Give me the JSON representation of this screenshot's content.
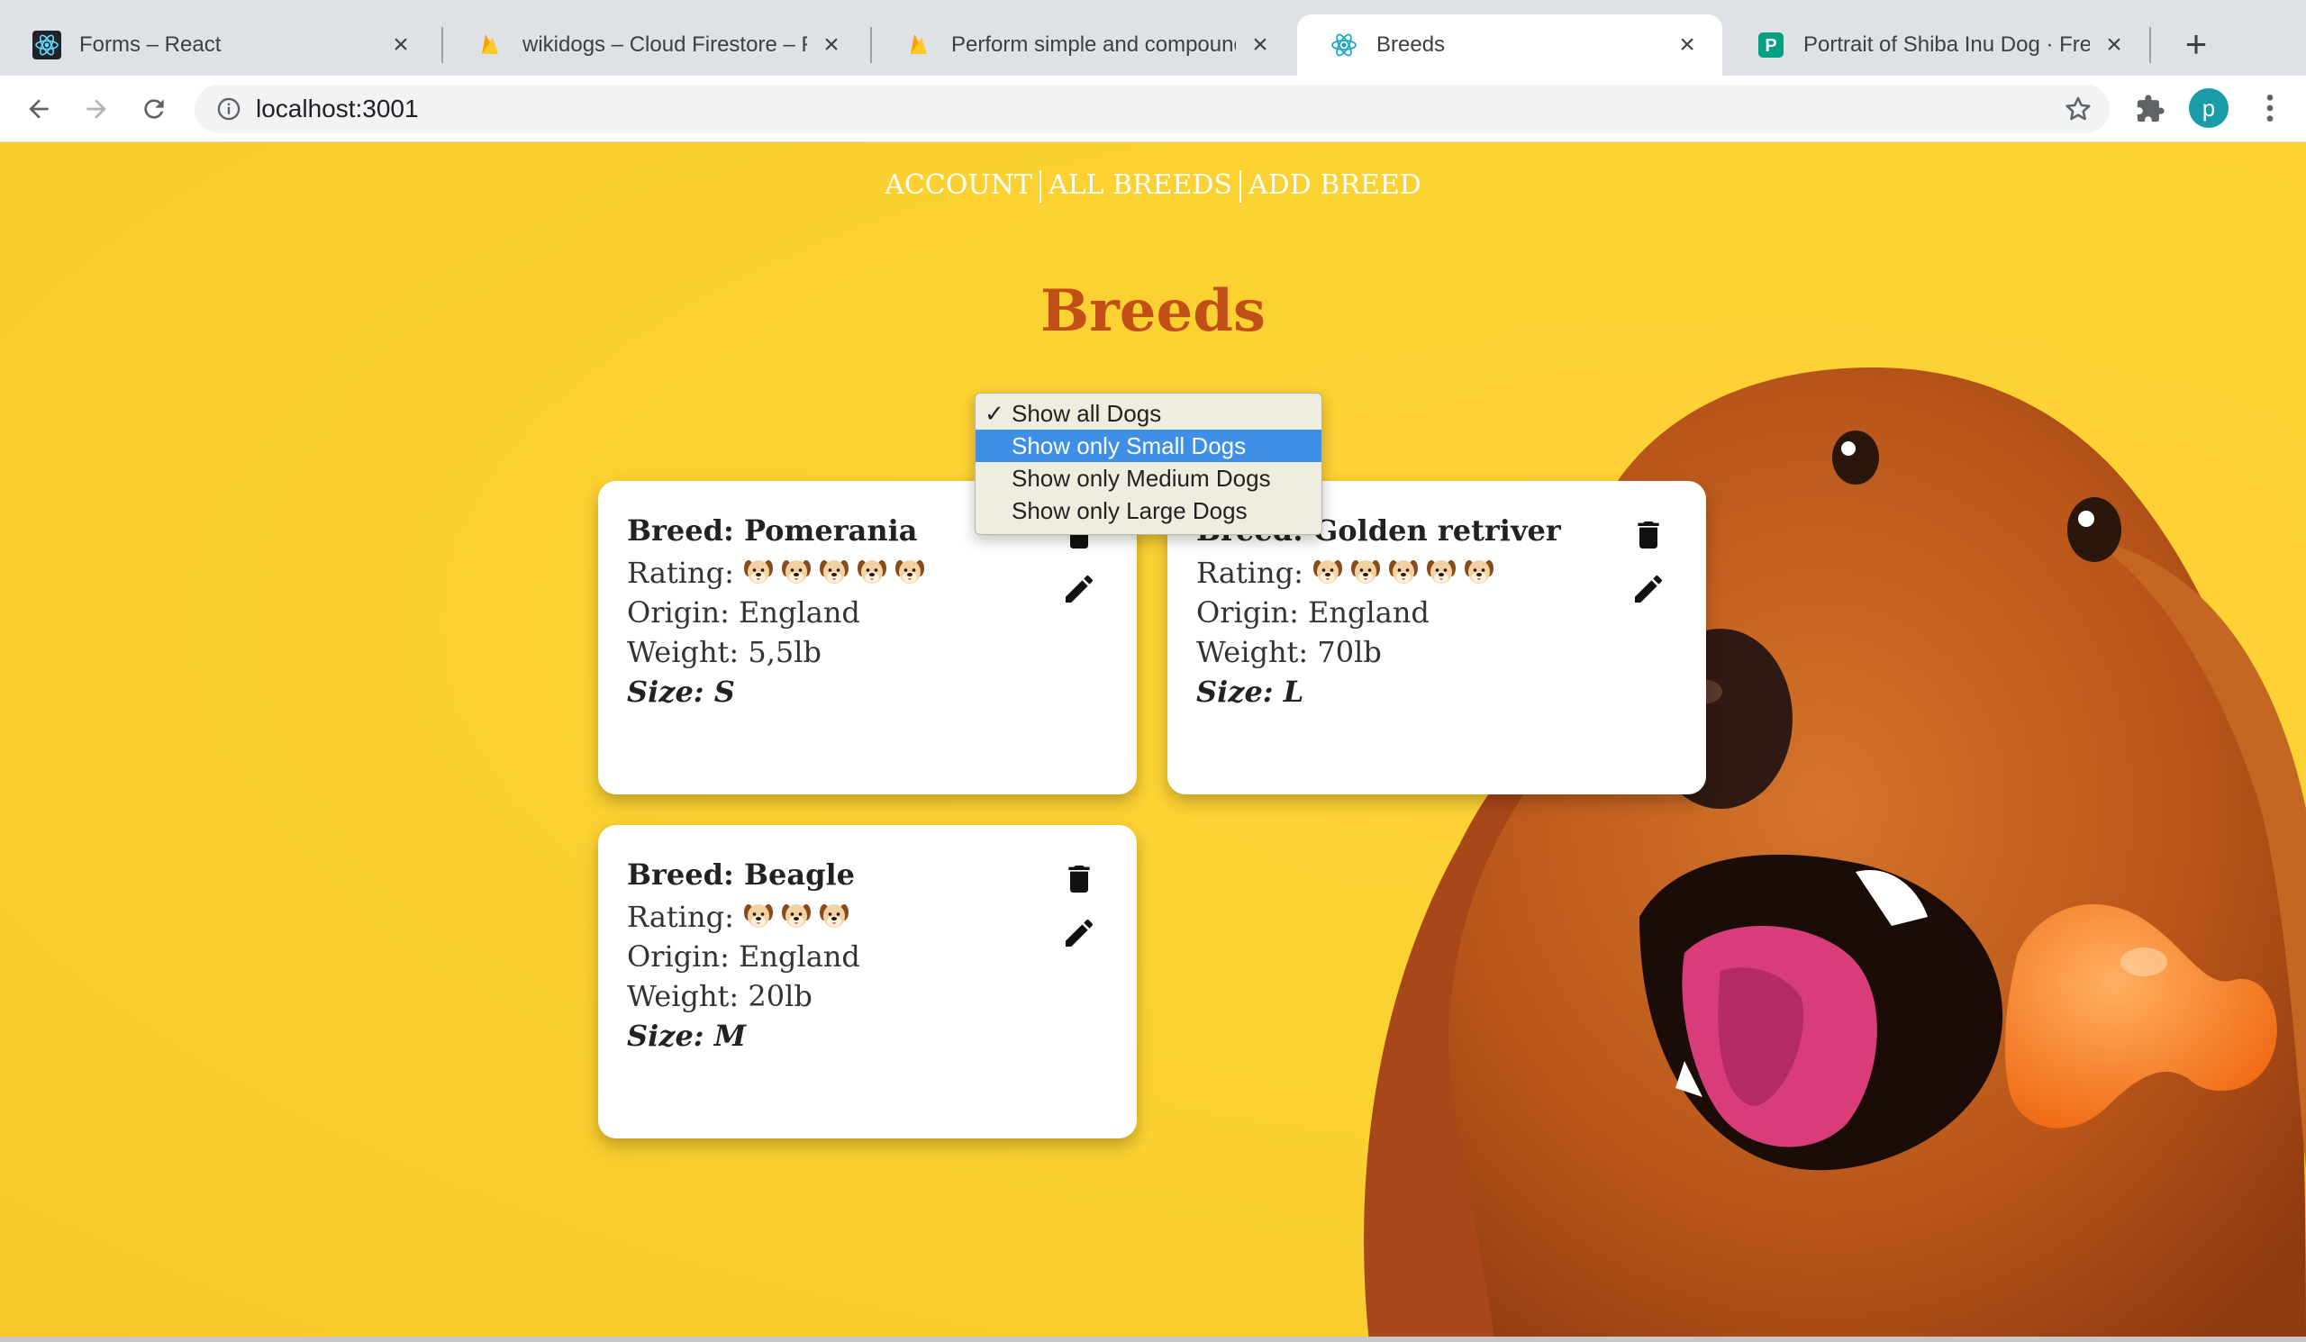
{
  "browser": {
    "tabs": [
      {
        "title": "Forms – React",
        "icon": "react-icon",
        "active": false
      },
      {
        "title": "wikidogs – Cloud Firestore – Fi",
        "icon": "firebase-icon",
        "active": false
      },
      {
        "title": "Perform simple and compound",
        "icon": "firebase-icon",
        "active": false
      },
      {
        "title": "Breeds",
        "icon": "react-icon",
        "active": true
      },
      {
        "title": "Portrait of Shiba Inu Dog · Free",
        "icon": "pexels-icon",
        "active": false
      }
    ],
    "url": "localhost:3001",
    "profile_initial": "p"
  },
  "nav": {
    "account": "ACCOUNT",
    "all_breeds": "ALL BREEDS",
    "add_breed": "ADD BREED"
  },
  "page_title": "Breeds",
  "filter": {
    "options": [
      {
        "label": "Show all Dogs",
        "checked": true,
        "highlighted": false
      },
      {
        "label": "Show only Small Dogs",
        "checked": false,
        "highlighted": true
      },
      {
        "label": "Show only Medium Dogs",
        "checked": false,
        "highlighted": false
      },
      {
        "label": "Show only Large Dogs",
        "checked": false,
        "highlighted": false
      }
    ],
    "check_mark": "✓"
  },
  "cards": [
    {
      "breed": "Breed: Pomerania",
      "rating_label": "Rating:",
      "rating": 5,
      "origin": "Origin: England",
      "weight": "Weight: 5,5lb",
      "size": "Size: S"
    },
    {
      "breed": "Breed: Golden retriver",
      "rating_label": "Rating:",
      "rating": 5,
      "origin": "Origin: England",
      "weight": "Weight: 70lb",
      "size": "Size: L"
    },
    {
      "breed": "Breed: Beagle",
      "rating_label": "Rating:",
      "rating": 3,
      "origin": "Origin: England",
      "weight": "Weight: 20lb",
      "size": "Size: M"
    }
  ],
  "colors": {
    "background": "#fcd232",
    "heading": "#c24e18",
    "highlight": "#3d8fe8"
  }
}
